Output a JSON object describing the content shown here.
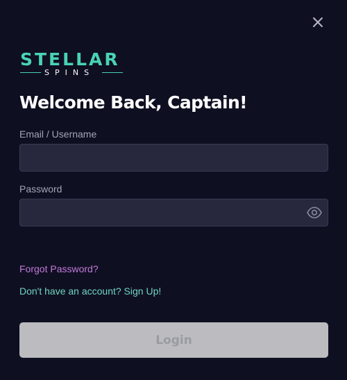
{
  "modal": {
    "close_icon": "close-icon",
    "logo": {
      "word_top": "STELLAR",
      "word_bottom": "SPINS",
      "color": "#49d3b4"
    },
    "heading": "Welcome Back, Captain!",
    "form": {
      "email_label": "Email / Username",
      "email_value": "",
      "email_placeholder": "",
      "password_label": "Password",
      "password_value": "",
      "password_placeholder": "",
      "password_toggle_icon": "eye-icon"
    },
    "links": {
      "forgot_password": "Forgot Password?",
      "signup": "Don't have an account? Sign Up!"
    },
    "login_button": {
      "label": "Login",
      "state": "disabled"
    },
    "colors": {
      "background": "#0f0f22",
      "input_bg": "#27283d",
      "accent_teal": "#49d3b4",
      "link_purple": "#c37ad8",
      "button_disabled": "#bcbcc0"
    }
  }
}
